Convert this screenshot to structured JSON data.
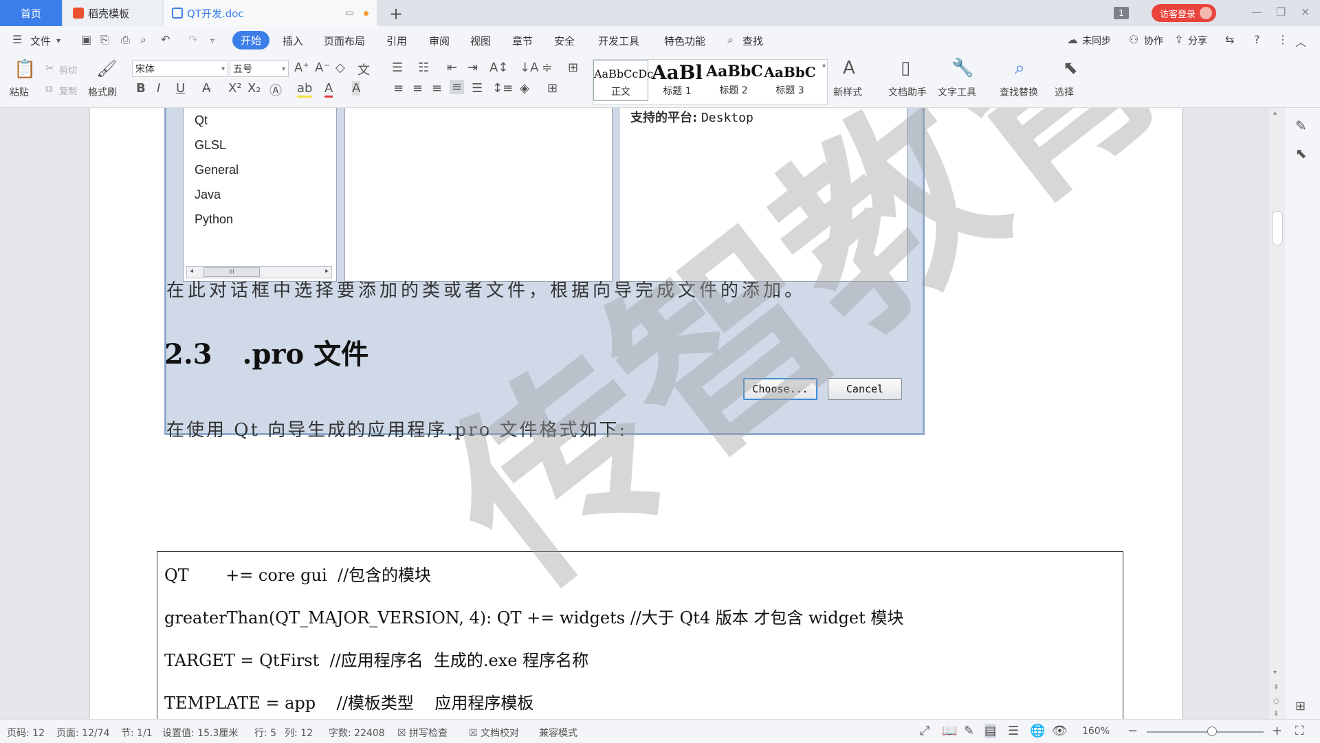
{
  "tabs": {
    "home": "首页",
    "templates": "稻壳模板",
    "document": "QT开发.doc",
    "new_tab": "+"
  },
  "window": {
    "badge_count": "1",
    "login_label": "访客登录"
  },
  "menu": {
    "file": "文件",
    "items": [
      "开始",
      "插入",
      "页面布局",
      "引用",
      "审阅",
      "视图",
      "章节",
      "安全",
      "开发工具",
      "特色功能"
    ],
    "search": "查找",
    "sync": "未同步",
    "collab": "协作",
    "share": "分享"
  },
  "ribbon": {
    "paste": "粘贴",
    "cut": "剪切",
    "copy": "复制",
    "format_painter": "格式刷",
    "font_name": "宋体",
    "font_size": "五号",
    "styles": [
      {
        "preview": "AaBbCcDc",
        "label": "正文"
      },
      {
        "preview": "AaBl",
        "label": "标题 1"
      },
      {
        "preview": "AaBbC",
        "label": "标题 2"
      },
      {
        "preview": "AaBbC",
        "label": "标题 3"
      }
    ],
    "new_style": "新样式",
    "doc_assistant": "文档助手",
    "text_tools": "文字工具",
    "find_replace": "查找替换",
    "select": "选择"
  },
  "dialog": {
    "languages": [
      "Qt",
      "GLSL",
      "General",
      "Java",
      "Python"
    ],
    "scroll_thumb": "III",
    "platform_label": "支持的平台:",
    "platform_value": "Desktop",
    "choose_button": "Choose...",
    "cancel_button": "Cancel"
  },
  "document": {
    "para1": "在此对话框中选择要添加的类或者文件，根据向导完成文件的添加。",
    "heading_number": "2.3",
    "heading_text": ".pro 文件",
    "para2": "在使用 Qt 向导生成的应用程序.pro 文件格式如下:",
    "code_lines": [
      "QT       += core gui  //包含的模块",
      "greaterThan(QT_MAJOR_VERSION, 4): QT += widgets //大于 Qt4 版本 才包含 widget 模块",
      "TARGET = QtFirst  //应用程序名  生成的.exe 程序名称",
      "TEMPLATE = app    //模板类型    应用程序模板"
    ],
    "watermark": "传智教育"
  },
  "status": {
    "page_num": "页码: 12",
    "pages": "页面: 12/74",
    "section": "节: 1/1",
    "position": "设置值: 15.3厘米",
    "row": "行: 5",
    "col": "列: 12",
    "word_count": "字数: 22408",
    "spell_check": "拼写检查",
    "doc_proof": "文档校对",
    "compat": "兼容模式",
    "zoom": "160%"
  }
}
